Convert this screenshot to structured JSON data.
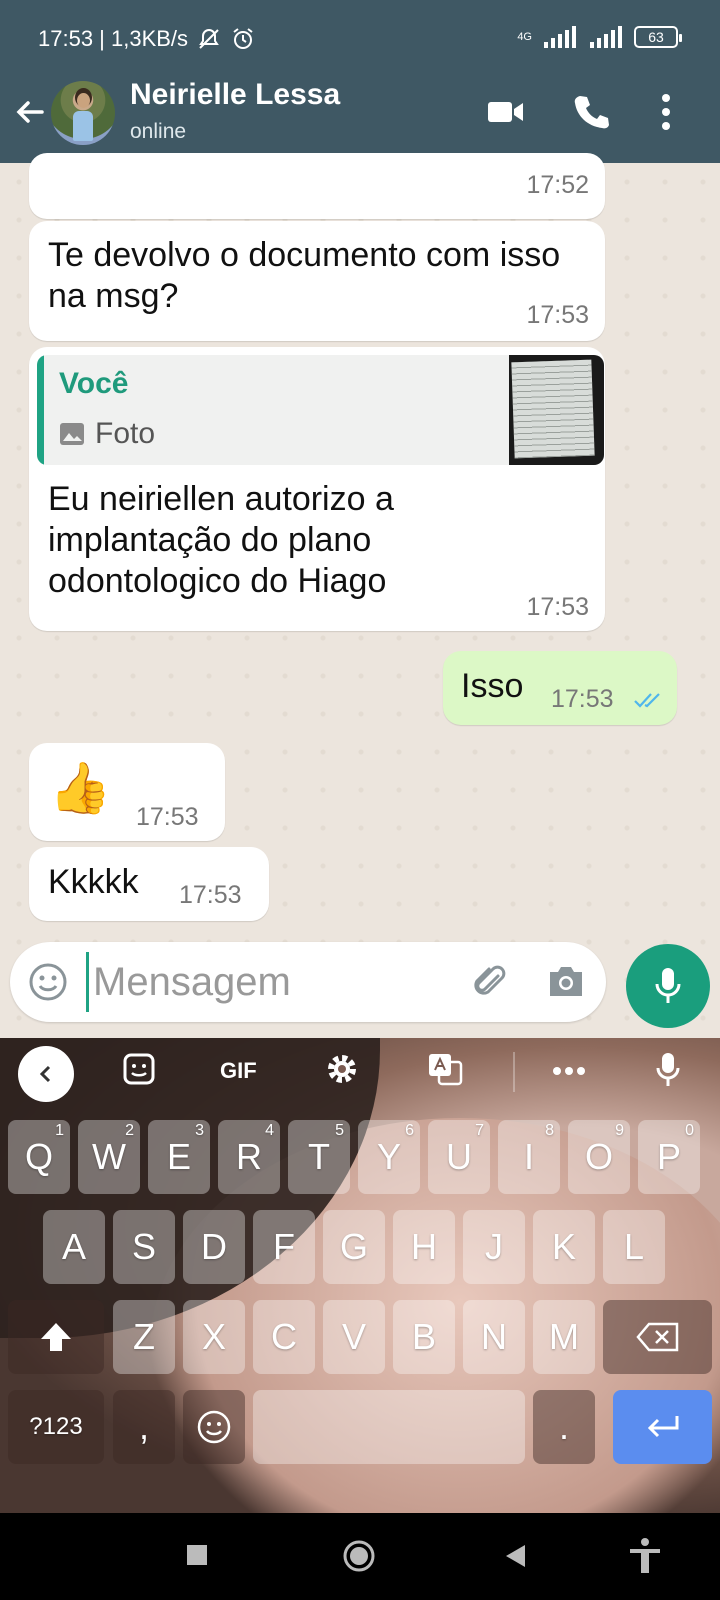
{
  "status_bar": {
    "time_speed": "17:53 | 1,3KB/s",
    "network": "4G",
    "battery": "63"
  },
  "header": {
    "contact_name": "Neirielle Lessa",
    "presence": "online"
  },
  "messages": [
    {
      "direction": "in",
      "text": "",
      "time": "17:52"
    },
    {
      "direction": "in",
      "text": "Te devolvo o documento com isso na msg?",
      "time": "17:53"
    },
    {
      "direction": "in",
      "quote": {
        "author": "Você",
        "type": "Foto"
      },
      "text": "Eu neiriellen  autorizo a implantação do plano odontologico do Hiago",
      "time": "17:53"
    },
    {
      "direction": "out",
      "text": "Isso",
      "time": "17:53",
      "status": "read"
    },
    {
      "direction": "in",
      "text": "👍",
      "time": "17:53"
    },
    {
      "direction": "in",
      "text": "Kkkkk",
      "time": "17:53"
    }
  ],
  "composer": {
    "placeholder": "Mensagem"
  },
  "keyboard": {
    "toolbar": {
      "gif_label": "GIF"
    },
    "row1": [
      {
        "key": "Q",
        "num": "1"
      },
      {
        "key": "W",
        "num": "2"
      },
      {
        "key": "E",
        "num": "3"
      },
      {
        "key": "R",
        "num": "4"
      },
      {
        "key": "T",
        "num": "5"
      },
      {
        "key": "Y",
        "num": "6"
      },
      {
        "key": "U",
        "num": "7"
      },
      {
        "key": "I",
        "num": "8"
      },
      {
        "key": "O",
        "num": "9"
      },
      {
        "key": "P",
        "num": "0"
      }
    ],
    "row2": [
      "A",
      "S",
      "D",
      "F",
      "G",
      "H",
      "J",
      "K",
      "L"
    ],
    "row3": [
      "Z",
      "X",
      "C",
      "V",
      "B",
      "N",
      "M"
    ],
    "symbols_label": "?123",
    "comma": ",",
    "period": "."
  }
}
